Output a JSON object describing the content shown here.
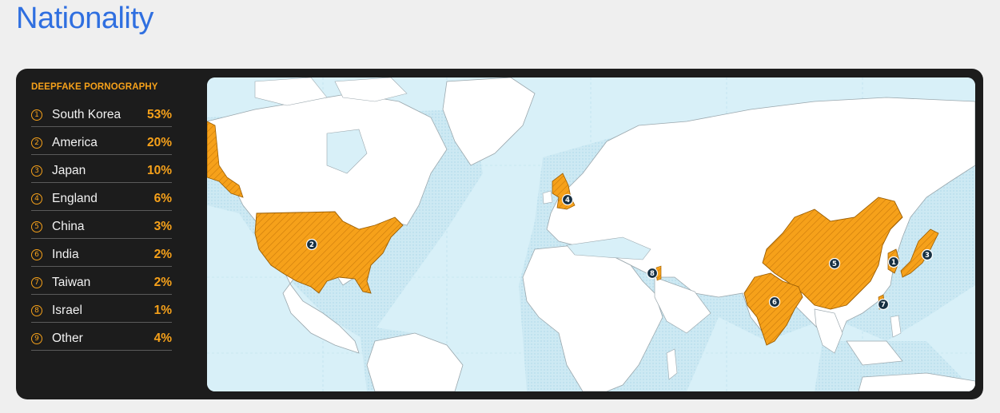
{
  "page": {
    "title": "Nationality"
  },
  "legend": {
    "heading": "DEEPFAKE PORNOGRAPHY",
    "rows": [
      {
        "rank": "1",
        "country": "South Korea",
        "percent": "53%"
      },
      {
        "rank": "2",
        "country": "America",
        "percent": "20%"
      },
      {
        "rank": "3",
        "country": "Japan",
        "percent": "10%"
      },
      {
        "rank": "4",
        "country": "England",
        "percent": "6%"
      },
      {
        "rank": "5",
        "country": "China",
        "percent": "3%"
      },
      {
        "rank": "6",
        "country": "India",
        "percent": "2%"
      },
      {
        "rank": "7",
        "country": "Taiwan",
        "percent": "2%"
      },
      {
        "rank": "8",
        "country": "Israel",
        "percent": "1%"
      },
      {
        "rank": "9",
        "country": "Other",
        "percent": "4%"
      }
    ]
  },
  "map": {
    "markers": [
      "1",
      "2",
      "3",
      "4",
      "5",
      "6",
      "7",
      "8"
    ]
  },
  "colors": {
    "accent": "#f6a11a",
    "title": "#2f6fe0",
    "card": "#1c1c1c",
    "ocean": "#d8f0f8",
    "land": "#ffffff",
    "highlight": "#f6a11a",
    "marker": "#173042"
  }
}
